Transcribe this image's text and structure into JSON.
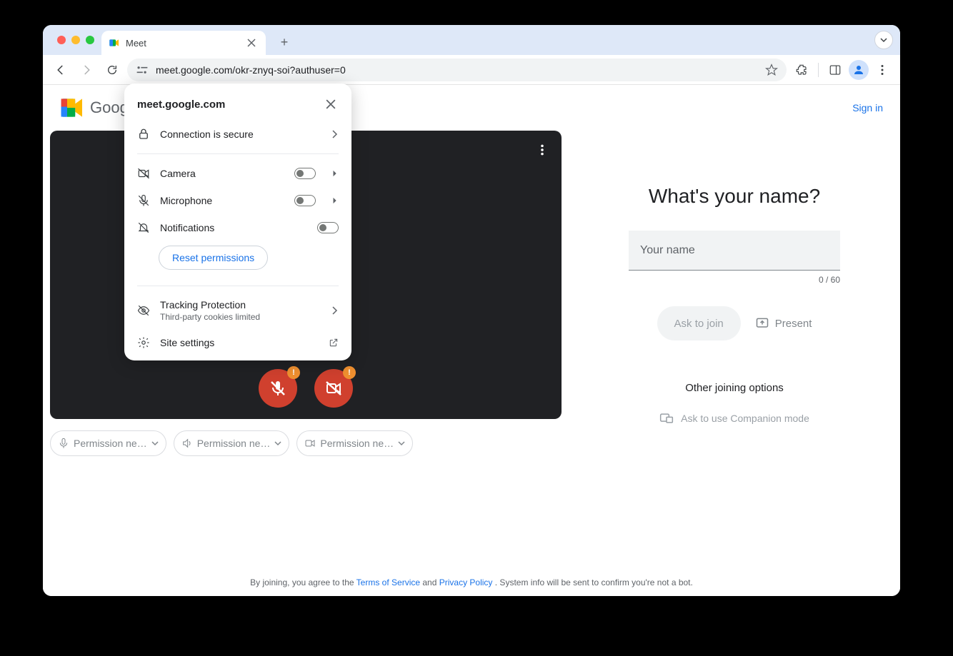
{
  "tab": {
    "title": "Meet"
  },
  "address": {
    "url": "meet.google.com/okr-znyq-soi?authuser=0"
  },
  "header": {
    "brand": "Google Meet",
    "signin": "Sign in"
  },
  "site_info": {
    "domain": "meet.google.com",
    "secure": "Connection is secure",
    "camera": "Camera",
    "mic": "Microphone",
    "notif": "Notifications",
    "reset": "Reset permissions",
    "tracking_title": "Tracking Protection",
    "tracking_sub": "Third-party cookies limited",
    "site_settings": "Site settings"
  },
  "chips": {
    "mic": "Permission ne…",
    "speaker": "Permission ne…",
    "camera": "Permission ne…"
  },
  "join": {
    "title": "What's your name?",
    "placeholder": "Your name",
    "counter": "0 / 60",
    "ask": "Ask to join",
    "present": "Present",
    "other": "Other joining options",
    "companion": "Ask to use Companion mode"
  },
  "footer": {
    "t1": "By joining, you agree to the ",
    "tos": "Terms of Service",
    "and": " and ",
    "privacy": "Privacy Policy",
    "t2": ". System info will be sent to confirm you're not a bot."
  }
}
